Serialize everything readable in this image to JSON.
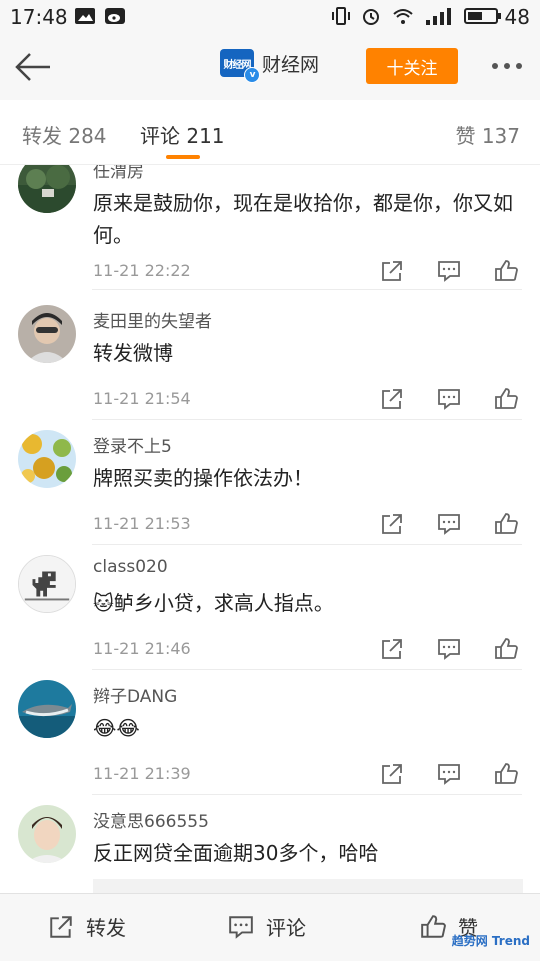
{
  "status_bar": {
    "time": "17:48",
    "battery": "48"
  },
  "header": {
    "logo_text": "财经网",
    "account_name": "财经网",
    "follow_label": "十关注",
    "verified_mark": "v"
  },
  "tabs": {
    "repost": "转发 284",
    "comment": "评论 211",
    "like": "赞 137"
  },
  "comments": [
    {
      "user": "任渭房",
      "text": "原来是鼓励你，现在是收拾你，都是你，你又如何。",
      "time": "11-21 22:22"
    },
    {
      "user": "麦田里的失望者",
      "text": "转发微博",
      "time": "11-21 21:54"
    },
    {
      "user": "登录不上5",
      "text": "牌照买卖的操作依法办！",
      "time": "11-21 21:53"
    },
    {
      "user": "class020",
      "text": "🐱鲈乡小贷，求高人指点。",
      "time": "11-21 21:46"
    },
    {
      "user": "辫子DANG",
      "text": "😂😂",
      "time": "11-21 21:39"
    },
    {
      "user": "没意思666555",
      "text": "反正网贷全面逾期30多个，哈哈",
      "time": ""
    }
  ],
  "bottom_bar": {
    "repost": "转发",
    "comment": "评论",
    "like": "赞"
  },
  "watermark": "趋势网 Trend",
  "colors": {
    "accent": "#ff8200",
    "background": "#f7f7f7"
  }
}
